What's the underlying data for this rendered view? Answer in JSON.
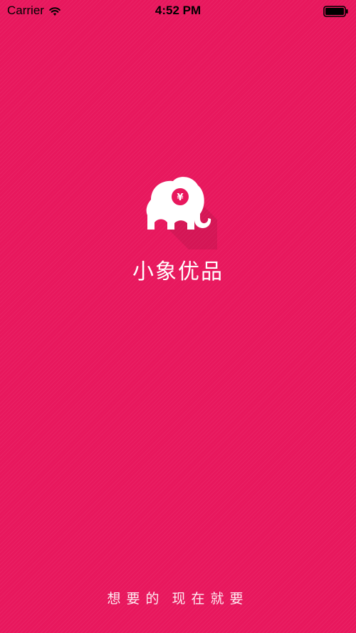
{
  "status_bar": {
    "carrier": "Carrier",
    "time": "4:52 PM",
    "icons": [
      "wifi-icon",
      "battery-icon"
    ]
  },
  "app": {
    "name": "小象优品",
    "logo_icon": "elephant-yen-logo-icon",
    "logo_symbol": "¥"
  },
  "tagline": {
    "part1": "想要的",
    "part2": "现在就要"
  },
  "colors": {
    "background": "#e8175d",
    "text": "#ffffff",
    "status_text": "#000000"
  }
}
